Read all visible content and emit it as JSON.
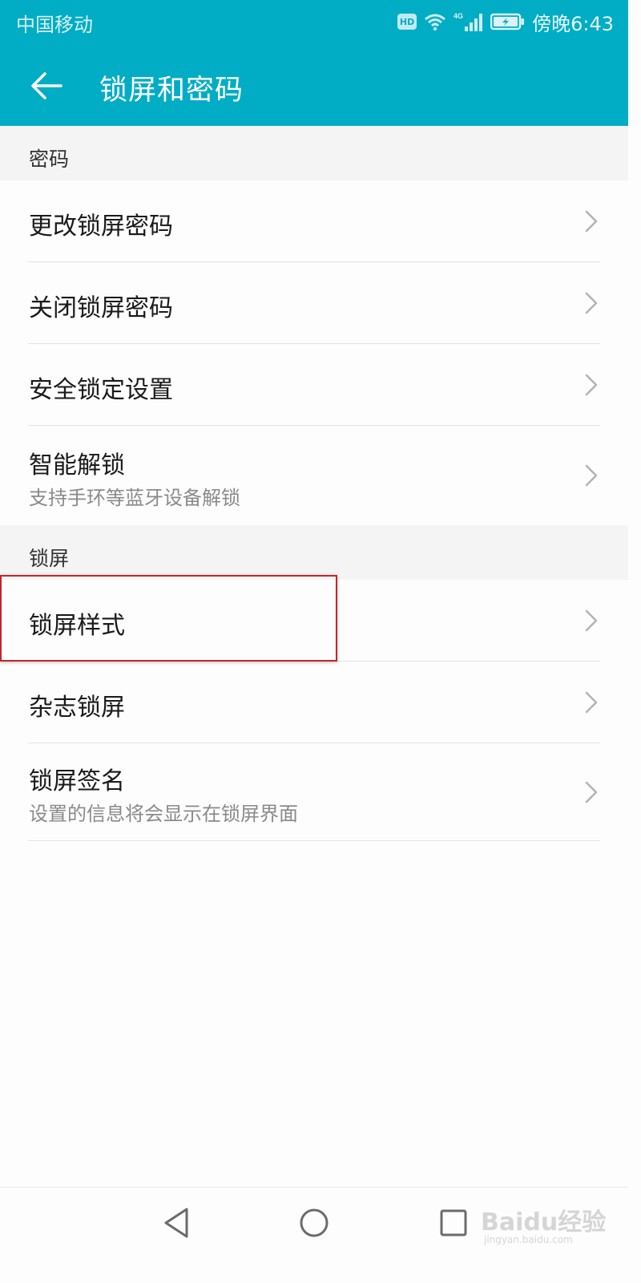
{
  "status_bar": {
    "carrier": "中国移动",
    "hd_badge": "HD",
    "network": "4G",
    "time": "傍晚6:43"
  },
  "app_bar": {
    "back_icon": "arrow-left-icon",
    "title": "锁屏和密码"
  },
  "sections": {
    "password": {
      "header": "密码",
      "items": [
        {
          "title": "更改锁屏密码"
        },
        {
          "title": "关闭锁屏密码"
        },
        {
          "title": "安全锁定设置"
        },
        {
          "title": "智能解锁",
          "subtitle": "支持手环等蓝牙设备解锁"
        }
      ]
    },
    "lockscreen": {
      "header": "锁屏",
      "items": [
        {
          "title": "锁屏样式"
        },
        {
          "title": "杂志锁屏"
        },
        {
          "title": "锁屏签名",
          "subtitle": "设置的信息将会显示在锁屏界面"
        }
      ]
    }
  },
  "nav_bar": {
    "back_icon": "triangle-back-icon",
    "home_icon": "circle-home-icon",
    "recents_icon": "square-recents-icon"
  },
  "watermark": {
    "brand": "Baidu经验",
    "url": "jingyan.baidu.com"
  },
  "colors": {
    "accent": "#00adc4",
    "highlight": "#c1272d",
    "section_bg": "#f4f4f4"
  }
}
